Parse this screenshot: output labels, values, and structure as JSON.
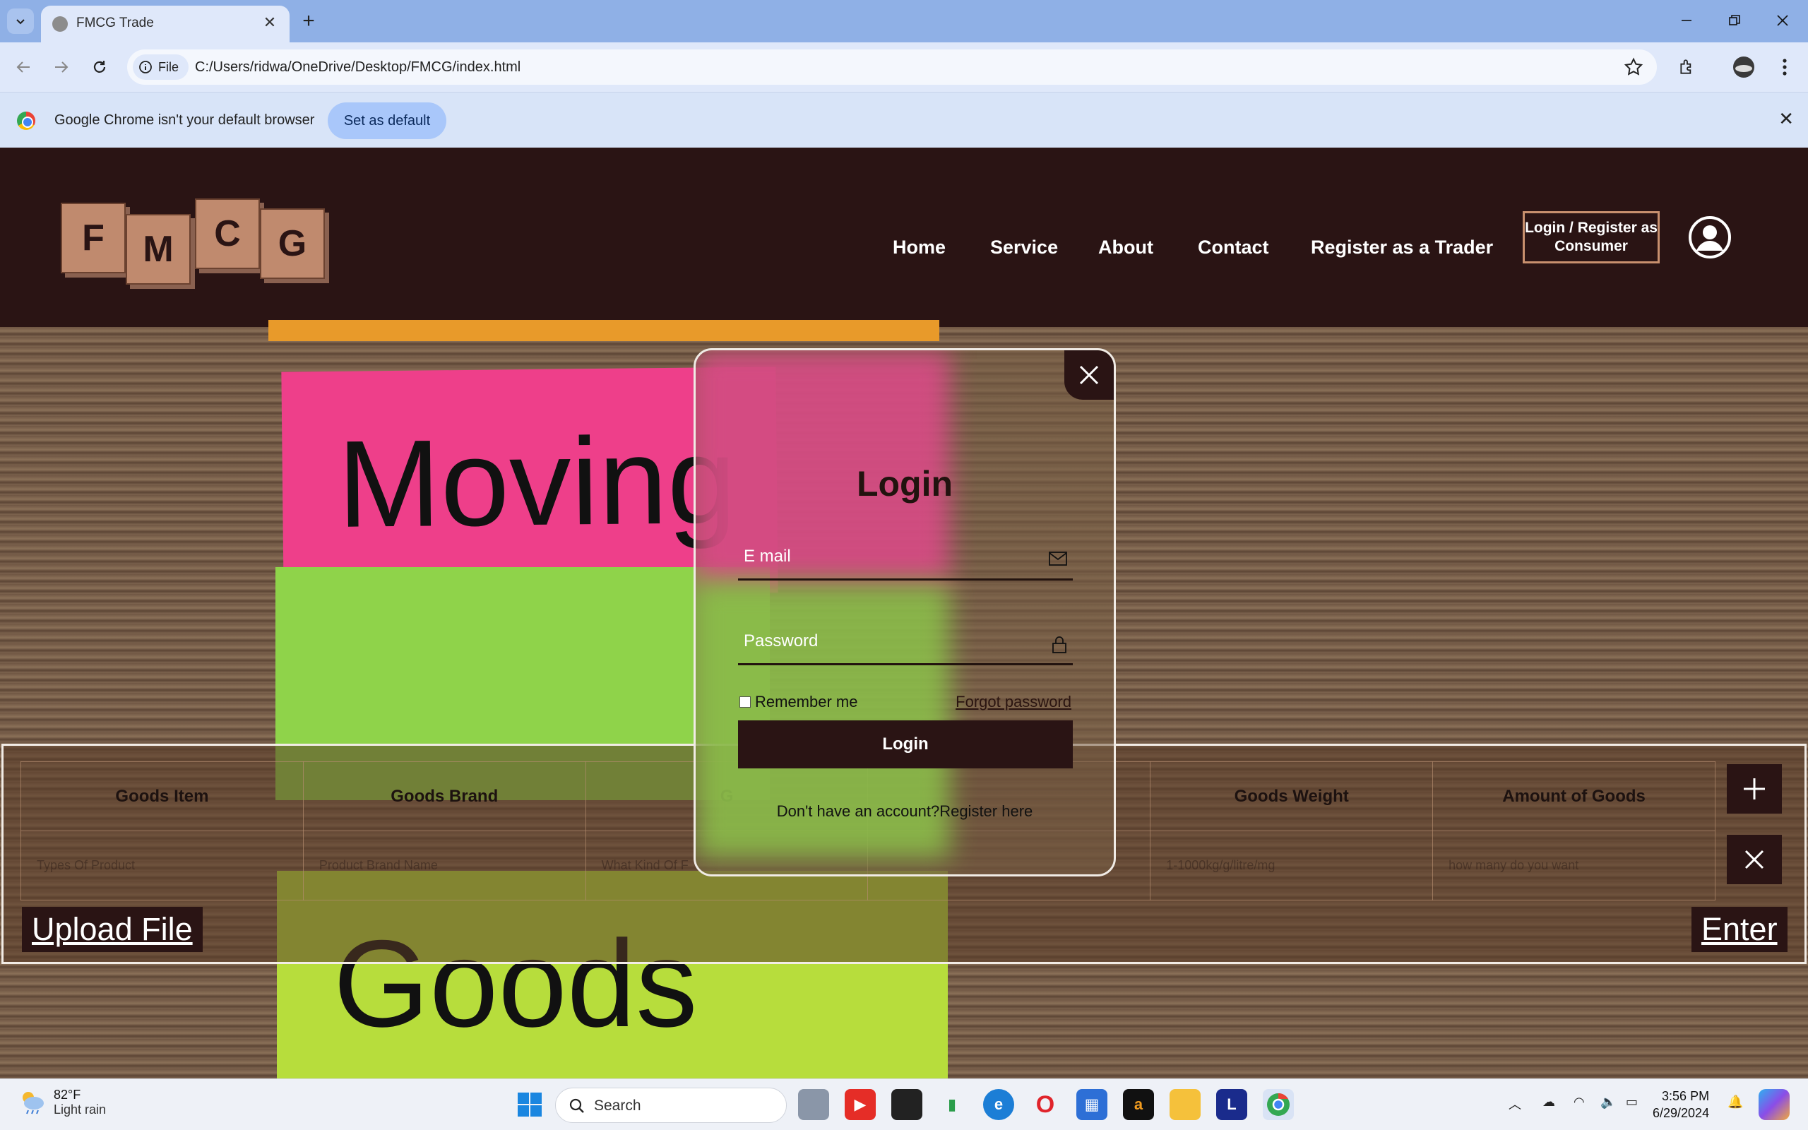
{
  "browser": {
    "tab_title": "FMCG Trade",
    "chip_label": "File",
    "url": "C:/Users/ridwa/OneDrive/Desktop/FMCG/index.html",
    "infobar_message": "Google Chrome isn't your default browser",
    "infobar_button": "Set as default"
  },
  "header": {
    "logo_letters": [
      "F",
      "M",
      "C",
      "G"
    ],
    "nav": [
      "Home",
      "Service",
      "About",
      "Contact",
      "Register as a Trader"
    ],
    "login_register": "Login / Register as Consumer"
  },
  "hero": {
    "word1": "Moving",
    "word2": "Goods"
  },
  "goods_form": {
    "columns": [
      "Goods Item",
      "Goods Brand",
      "G",
      "",
      "Goods Weight",
      "Amount of Goods"
    ],
    "placeholders": [
      "Types Of Product",
      "Product Brand Name",
      "What Kind Of F",
      "",
      "1-1000kg/g/litre/mg",
      "how many do you want"
    ],
    "upload_label": "Upload File",
    "enter_label": "Enter"
  },
  "login_modal": {
    "title": "Login",
    "email_placeholder": "E mail",
    "password_placeholder": "Password",
    "remember_label": "Remember me",
    "forgot_label": "Forgot password",
    "login_button": "Login",
    "register_prompt": "Don't have an account?Register here"
  },
  "taskbar": {
    "temperature": "82°F",
    "weather_desc": "Light rain",
    "search_label": "Search",
    "time": "3:56 PM",
    "date": "6/29/2024"
  }
}
